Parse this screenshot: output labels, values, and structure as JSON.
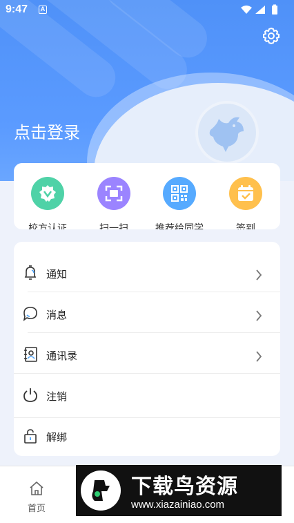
{
  "status_bar": {
    "time": "9:47",
    "notification_glyph": "A"
  },
  "header": {
    "login_text": "点击登录",
    "settings_icon": "gear-icon",
    "avatar_icon": "bird-avatar-icon",
    "color": "#5b9bff"
  },
  "quick_actions": [
    {
      "label": "校方认证",
      "icon": "verified-badge-icon",
      "color": "#4fd2a7"
    },
    {
      "label": "扫一扫",
      "icon": "scan-icon",
      "color": "#9b84ff"
    },
    {
      "label": "推荐给同学",
      "icon": "qr-code-icon",
      "color": "#56aaff"
    },
    {
      "label": "签到",
      "icon": "calendar-check-icon",
      "color": "#ffc04d"
    }
  ],
  "menu": [
    {
      "label": "通知",
      "icon": "bell-icon",
      "chevron": true
    },
    {
      "label": "消息",
      "icon": "chat-icon",
      "chevron": true
    },
    {
      "label": "通讯录",
      "icon": "contacts-icon",
      "chevron": true
    },
    {
      "label": "注销",
      "icon": "power-icon",
      "chevron": false
    },
    {
      "label": "解绑",
      "icon": "lock-icon",
      "chevron": false
    }
  ],
  "bottom_nav": {
    "home_label": "首页",
    "home_icon": "home-icon"
  },
  "watermark": {
    "title": "下载鸟资源",
    "url": "www.xiazainiao.com"
  }
}
